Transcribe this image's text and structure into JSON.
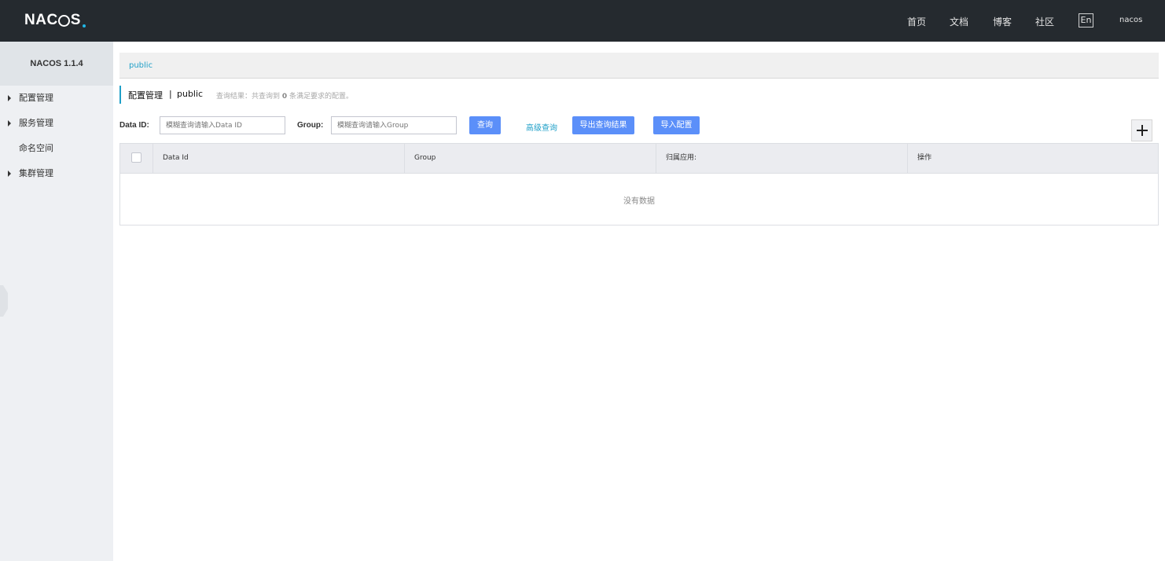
{
  "header": {
    "logo": {
      "n": "NA",
      "c": "C",
      "s": "S",
      "ring": "O",
      "dot": "."
    },
    "nav": [
      "首页",
      "文档",
      "博客",
      "社区"
    ],
    "lang": "En",
    "user": "nacos"
  },
  "sidebar": {
    "title": "NACOS 1.1.4",
    "items": [
      {
        "label": "配置管理",
        "expandable": true
      },
      {
        "label": "服务管理",
        "expandable": true
      },
      {
        "label": "命名空间",
        "expandable": false
      },
      {
        "label": "集群管理",
        "expandable": true
      }
    ]
  },
  "breadcrumb": {
    "namespace": "public"
  },
  "page": {
    "title": "配置管理",
    "separator": "|",
    "namespace": "public",
    "result_prefix": "查询结果：共查询到",
    "result_count": "0",
    "result_suffix": "条满足要求的配置。"
  },
  "filters": {
    "data_id_label": "Data ID:",
    "data_id_placeholder": "模糊查询请输入Data ID",
    "group_label": "Group:",
    "group_placeholder": "模糊查询请输入Group",
    "query_button": "查询",
    "advanced_query": "高级查询",
    "export_button": "导出查询结果",
    "import_button": "导入配置"
  },
  "table": {
    "columns": [
      "Data Id",
      "Group",
      "归属应用:",
      "操作"
    ],
    "empty_text": "没有数据"
  },
  "colors": {
    "accent": "#5b8ff9",
    "link": "#20a0c8",
    "header_bg": "#252a2f"
  }
}
